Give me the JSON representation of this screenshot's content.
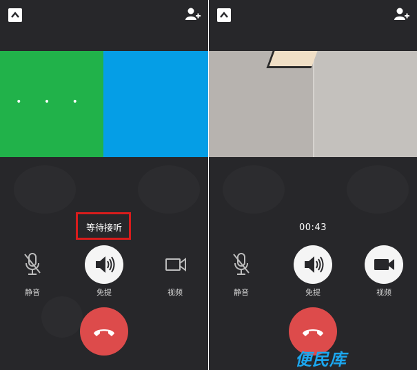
{
  "left_screen": {
    "dots": "• • •",
    "status_text": "等待接听",
    "controls": {
      "mute_label": "静音",
      "speaker_label": "免提",
      "video_label": "视频"
    }
  },
  "right_screen": {
    "timer": "00:43",
    "controls": {
      "mute_label": "静音",
      "speaker_label": "免提",
      "video_label": "视频"
    }
  },
  "watermark": "便民库",
  "colors": {
    "background": "#27272a",
    "green_tile": "#21b24a",
    "blue_tile": "#059ee6",
    "hangup": "#dd4b4b",
    "highlight_box": "#d91c1c",
    "watermark": "#1ba7f0"
  },
  "icons": [
    "minimize-icon",
    "add-person-icon",
    "microphone-icon",
    "speaker-icon",
    "video-camera-icon",
    "hang-up-icon"
  ]
}
